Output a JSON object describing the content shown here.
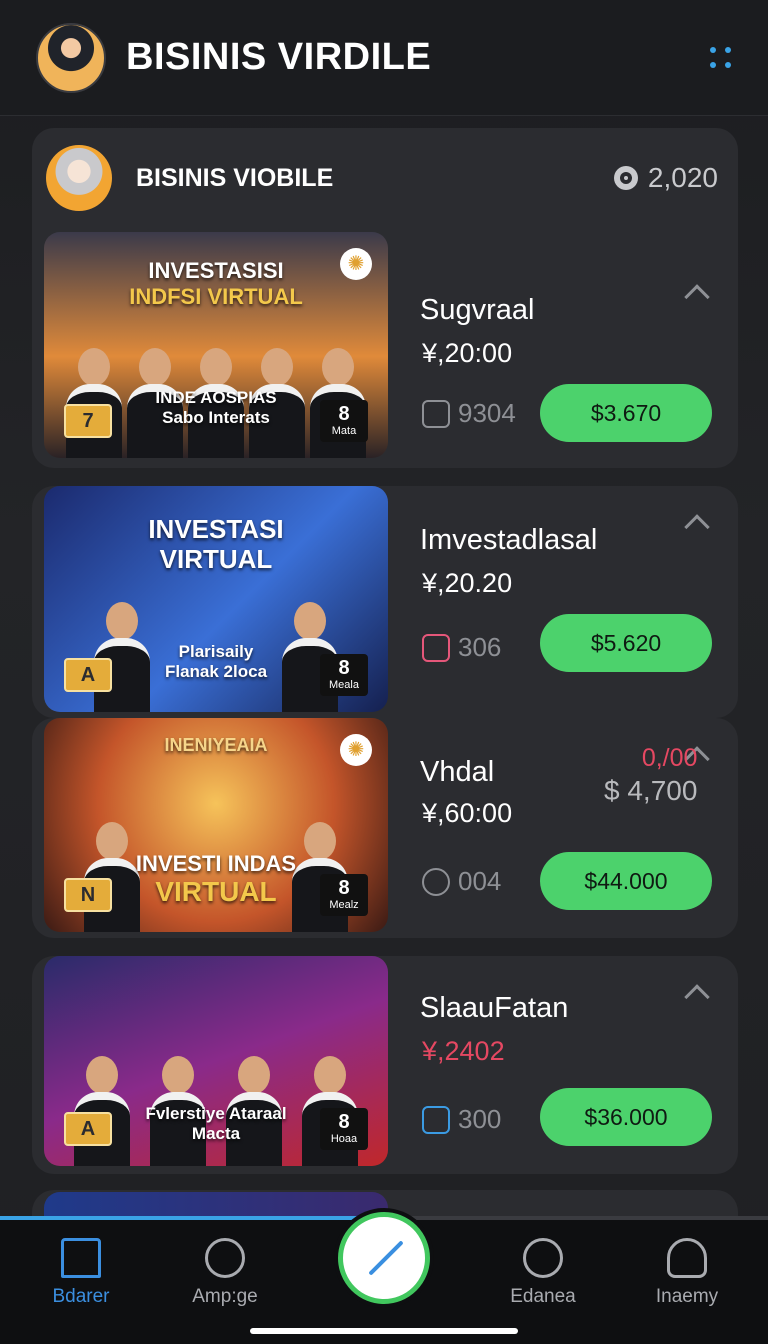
{
  "header": {
    "title": "BISINIS VIRDILE"
  },
  "section": {
    "title": "BISINIS VIOBILE",
    "count": "2,020"
  },
  "cards": [
    {
      "thumb_title": [
        "INVESTASISI",
        "INDFSI VIRTUAL"
      ],
      "thumb_caption": [
        "INDE AOSPIAS",
        "Sabo Interats"
      ],
      "badge_left": "7",
      "badge_right": "Mata",
      "name": "Sugvraal",
      "price": "¥,20:00",
      "meta": "9304",
      "buy": "$3.670"
    },
    {
      "thumb_title": [
        "INVESTASI",
        "VIRTUAL"
      ],
      "thumb_caption": [
        "Plarisaily",
        "Flanak 2loca"
      ],
      "badge_left": "A",
      "badge_right": "Meala",
      "name": "Imvestadlasal",
      "price": "¥,20.20",
      "meta": "306",
      "buy": "$5.620"
    },
    {
      "thumb_title": [
        "INENIYEAIA",
        ""
      ],
      "thumb_caption": [
        "INVESTI INDAS",
        "VIRTUAL"
      ],
      "badge_left": "N",
      "badge_right": "Mealz",
      "name": "Vhdal",
      "price": "¥,60:00",
      "extra_red": "0,/00",
      "extra_grey": "$ 4,700",
      "meta": "004",
      "buy": "$44.000"
    },
    {
      "thumb_title": [
        "",
        ""
      ],
      "thumb_caption": [
        "Fvlerstiye Ataraal",
        "Macta"
      ],
      "badge_left": "A",
      "badge_right": "Hoaa",
      "name": "SlaauFatan",
      "price": "¥,2402",
      "meta": "300",
      "buy": "$36.000"
    }
  ],
  "nav": [
    {
      "label": "Bdarer"
    },
    {
      "label": "Amp:ge"
    },
    {
      "label": "Edanea"
    },
    {
      "label": "Inaemy"
    }
  ],
  "progress": 0.52,
  "colors": {
    "accent": "#3aa3e6",
    "buy": "#4cd26c",
    "red": "#e54862",
    "bg": "#1e1f22"
  }
}
